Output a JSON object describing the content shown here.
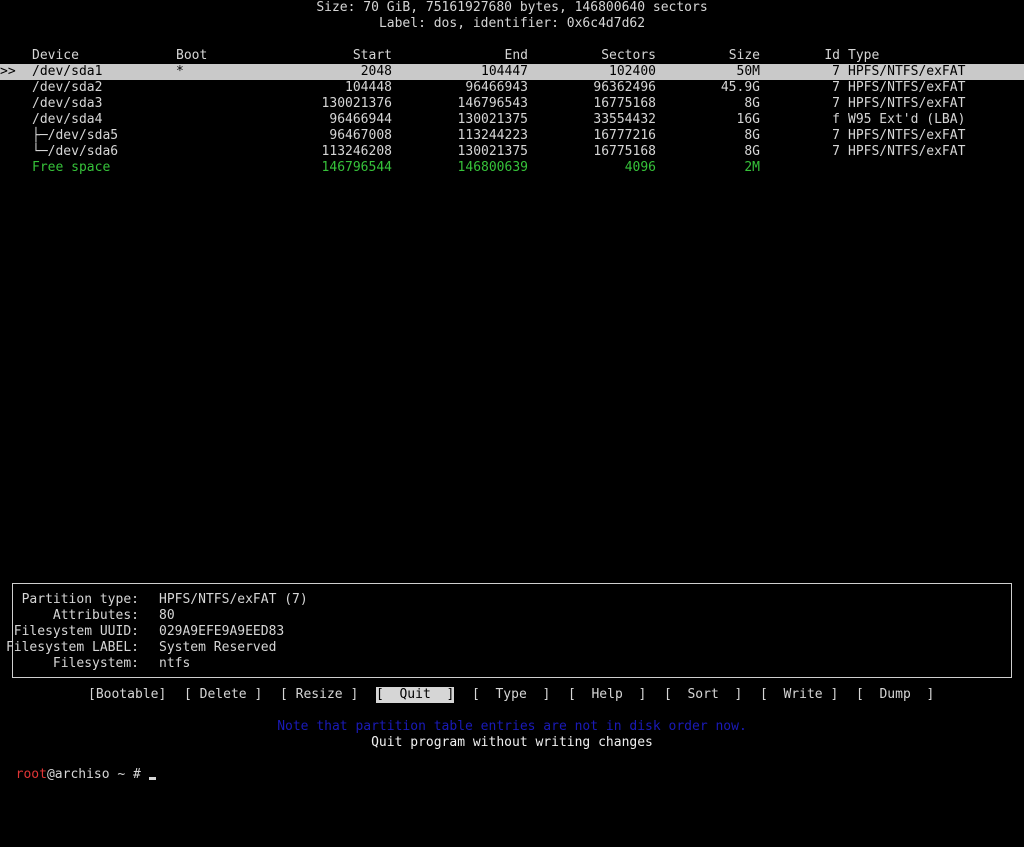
{
  "header": {
    "size_line": "Size: 70 GiB, 75161927680 bytes, 146800640 sectors",
    "label_line": "Label: dos, identifier: 0x6c4d7d62"
  },
  "table": {
    "columns": {
      "device": "Device",
      "boot": "Boot",
      "start": "Start",
      "end": "End",
      "sectors": "Sectors",
      "size": "Size",
      "id": "Id",
      "type": "Type"
    },
    "selection_marker": ">>",
    "rows": [
      {
        "device": "/dev/sda1",
        "boot": "*",
        "start": "2048",
        "end": "104447",
        "sectors": "102400",
        "size": "50M",
        "id": "7",
        "type": "HPFS/NTFS/exFAT"
      },
      {
        "device": "/dev/sda2",
        "boot": "",
        "start": "104448",
        "end": "96466943",
        "sectors": "96362496",
        "size": "45.9G",
        "id": "7",
        "type": "HPFS/NTFS/exFAT"
      },
      {
        "device": "/dev/sda3",
        "boot": "",
        "start": "130021376",
        "end": "146796543",
        "sectors": "16775168",
        "size": "8G",
        "id": "7",
        "type": "HPFS/NTFS/exFAT"
      },
      {
        "device": "/dev/sda4",
        "boot": "",
        "start": "96466944",
        "end": "130021375",
        "sectors": "33554432",
        "size": "16G",
        "id": "f",
        "type": "W95 Ext'd (LBA)"
      },
      {
        "device": "├─/dev/sda5",
        "boot": "",
        "start": "96467008",
        "end": "113244223",
        "sectors": "16777216",
        "size": "8G",
        "id": "7",
        "type": "HPFS/NTFS/exFAT"
      },
      {
        "device": "└─/dev/sda6",
        "boot": "",
        "start": "113246208",
        "end": "130021375",
        "sectors": "16775168",
        "size": "8G",
        "id": "7",
        "type": "HPFS/NTFS/exFAT"
      }
    ],
    "free_space": {
      "device": "Free space",
      "start": "146796544",
      "end": "146800639",
      "sectors": "4096",
      "size": "2M"
    }
  },
  "details": {
    "partition_type_label": "Partition type:",
    "partition_type_value": "HPFS/NTFS/exFAT (7)",
    "attributes_label": "Attributes:",
    "attributes_value": "80",
    "fs_uuid_label": "Filesystem UUID:",
    "fs_uuid_value": "029A9EFE9A9EED83",
    "fs_label_label": "Filesystem LABEL:",
    "fs_label_value": "System Reserved",
    "filesystem_label": "Filesystem:",
    "filesystem_value": "ntfs"
  },
  "menu": {
    "bootable": "[Bootable]",
    "delete": "[ Delete ]",
    "resize": "[ Resize ]",
    "quit": "[  Quit  ]",
    "type": "[  Type  ]",
    "help": "[  Help  ]",
    "sort": "[  Sort  ]",
    "write": "[  Write ]",
    "dump": "[  Dump  ]"
  },
  "footer": {
    "note": "Note that partition table entries are not in disk order now.",
    "hint": "Quit program without writing changes"
  },
  "prompt": {
    "user": "root",
    "host_and_path": "@archiso ~ #"
  },
  "colors": {
    "background": "#000000",
    "text": "#d6d6d6",
    "selected_row_bg": "#c9c9c9",
    "free_space": "#36c23a",
    "note": "#1a1ab8",
    "prompt_user": "#e03535"
  }
}
